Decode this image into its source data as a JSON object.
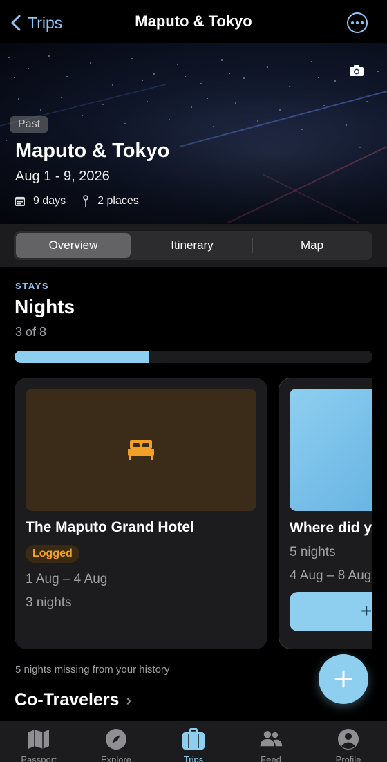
{
  "nav": {
    "back_label": "Trips",
    "title": "Maputo & Tokyo"
  },
  "hero": {
    "badge": "Past",
    "title": "Maputo & Tokyo",
    "dates": "Aug 1 - 9, 2026",
    "days": "9 days",
    "places": "2 places"
  },
  "segments": [
    "Overview",
    "Itinerary",
    "Map"
  ],
  "stays": {
    "label": "STAYS",
    "title": "Nights",
    "count": "3 of 8",
    "progress_fraction": 0.375
  },
  "cards": [
    {
      "title": "The Maputo Grand Hotel",
      "badge": "Logged",
      "dates": "1 Aug – 4 Aug",
      "nights": "3 nights"
    },
    {
      "title": "Where did y",
      "nights": "5 nights",
      "dates": "4 Aug – 8 Aug",
      "button_icon": "+"
    }
  ],
  "missing_note": "5 nights missing from your history",
  "cotravelers": {
    "title": "Co-Travelers",
    "chevron": "›"
  },
  "fab_icon": "+",
  "tabs": [
    "Passport",
    "Explore",
    "Trips",
    "Feed",
    "Profile"
  ],
  "colors": {
    "accent": "#8ecff0",
    "logged": "#f3a027",
    "background": "#000000",
    "card": "#1c1c1e"
  }
}
